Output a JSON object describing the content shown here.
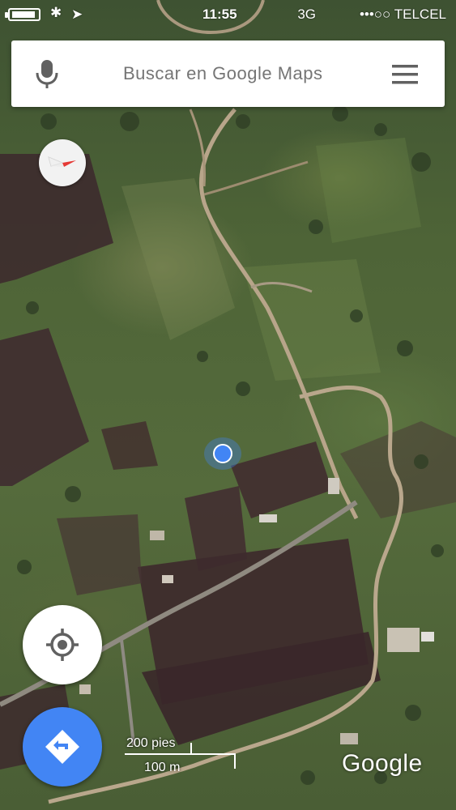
{
  "status_bar": {
    "carrier": "•••○○ TELCEL",
    "network": "3G",
    "time": "11:55",
    "bluetooth_glyph": "✱",
    "location_glyph": "➤"
  },
  "search": {
    "placeholder": "Buscar en Google Maps"
  },
  "map": {
    "attribution": "Google",
    "scale_top": "200 pies",
    "scale_bottom": "100 m"
  },
  "icons": {
    "mic": "microphone-icon",
    "menu": "hamburger-menu-icon",
    "compass": "compass-icon",
    "locate": "my-location-icon",
    "directions": "directions-icon"
  },
  "colors": {
    "accent": "#4285f4",
    "compass_red": "#e53935"
  }
}
